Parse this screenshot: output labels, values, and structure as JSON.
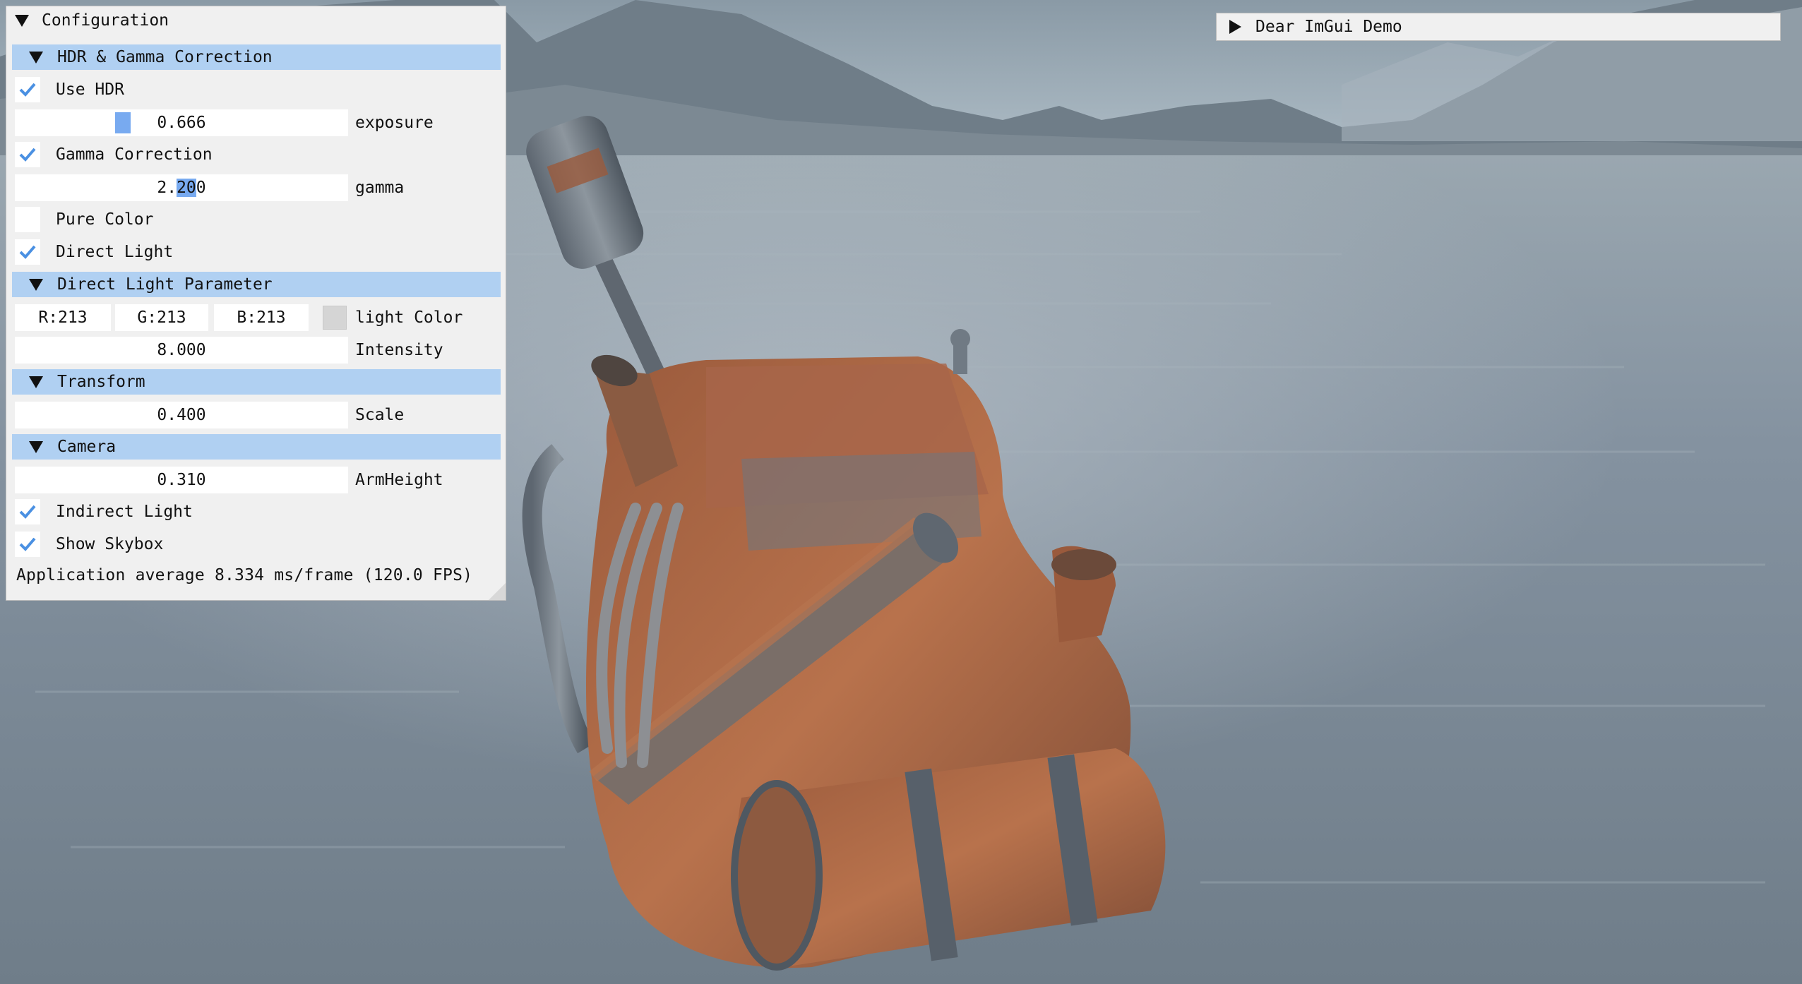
{
  "config_window": {
    "title": "Configuration",
    "sections": {
      "hdr": "HDR & Gamma Correction",
      "direct_light": "Direct Light Parameter",
      "transform": "Transform",
      "camera": "Camera"
    },
    "use_hdr": {
      "label": "Use HDR",
      "checked": true
    },
    "exposure": {
      "label": "exposure",
      "value": "0.666"
    },
    "gamma_correction": {
      "label": "Gamma Correction",
      "checked": true
    },
    "gamma": {
      "label": "gamma",
      "value_pre": "2.",
      "value_sel": "20",
      "value_post": "0"
    },
    "pure_color": {
      "label": "Pure Color",
      "checked": false
    },
    "direct_light": {
      "label": "Direct Light",
      "checked": true
    },
    "light_color": {
      "label": "light Color",
      "r": "R:213",
      "g": "G:213",
      "b": "B:213",
      "swatch": "#d5d5d5"
    },
    "intensity": {
      "label": "Intensity",
      "value": "8.000"
    },
    "scale": {
      "label": "Scale",
      "value": "0.400"
    },
    "arm_height": {
      "label": "ArmHeight",
      "value": "0.310"
    },
    "indirect_light": {
      "label": "Indirect Light",
      "checked": true
    },
    "show_skybox": {
      "label": "Show Skybox",
      "checked": true
    },
    "stats": "Application average 8.334 ms/frame (120.0 FPS)"
  },
  "demo_window": {
    "title": "Dear ImGui Demo"
  },
  "colors": {
    "window_bg": "#f0f0f0",
    "header_bg": "#b0d0f2",
    "accent": "#78aaf0",
    "check": "#4a90e2"
  }
}
